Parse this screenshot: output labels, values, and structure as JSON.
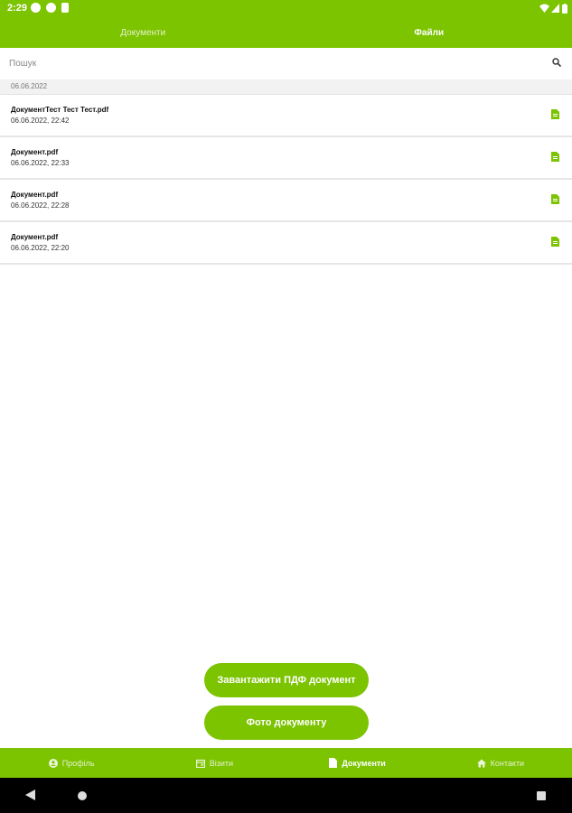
{
  "status_bar": {
    "time": "2:29"
  },
  "tabs": [
    {
      "label": "Документи",
      "active": false
    },
    {
      "label": "Файли",
      "active": true
    }
  ],
  "search": {
    "placeholder": "Пошук",
    "value": ""
  },
  "date_group": "06.06.2022",
  "files": [
    {
      "name": "ДокументТест Тест Тест.pdf",
      "date": "06.06.2022, 22:42"
    },
    {
      "name": "Документ.pdf",
      "date": "06.06.2022, 22:33"
    },
    {
      "name": "Документ.pdf",
      "date": "06.06.2022, 22:28"
    },
    {
      "name": "Документ.pdf",
      "date": "06.06.2022, 22:20"
    }
  ],
  "buttons": {
    "upload_pdf": "Завантажити ПДФ документ",
    "photo": "Фото документу"
  },
  "bottom_nav": [
    {
      "label": "Профіль",
      "icon": "account-circle-icon",
      "active": false
    },
    {
      "label": "Візити",
      "icon": "calendar-icon",
      "active": false
    },
    {
      "label": "Документи",
      "icon": "document-icon",
      "active": true
    },
    {
      "label": "Контакти",
      "icon": "home-icon",
      "active": false
    }
  ],
  "colors": {
    "accent": "#7cc300"
  }
}
